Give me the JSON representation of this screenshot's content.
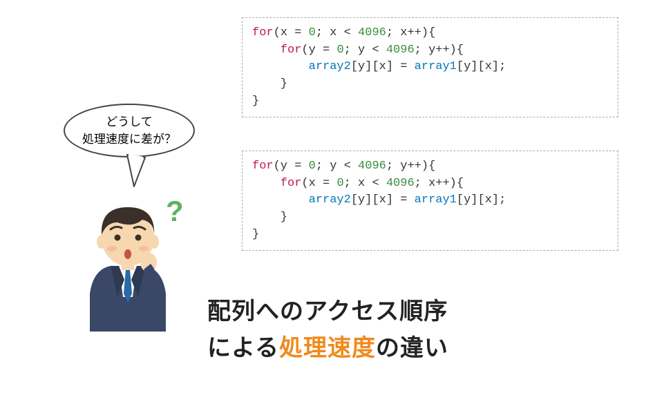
{
  "bubble": {
    "line1": "どうして",
    "line2": "処理速度に差が？"
  },
  "code1": {
    "outer_kw": "for",
    "outer_open": "(x = ",
    "outer_init": "0",
    "outer_cond": "; x < ",
    "outer_limit": "4096",
    "outer_inc": "; x++){",
    "inner_kw": "for",
    "inner_open": "(y = ",
    "inner_init": "0",
    "inner_cond": "; y < ",
    "inner_limit": "4096",
    "inner_inc": "; y++){",
    "arr2": "array2",
    "idx_mid": "[y][x] = ",
    "arr1": "array1",
    "idx_end": "[y][x];",
    "close_inner": "    }",
    "close_outer": "}"
  },
  "code2": {
    "outer_kw": "for",
    "outer_open": "(y = ",
    "outer_init": "0",
    "outer_cond": "; y < ",
    "outer_limit": "4096",
    "outer_inc": "; y++){",
    "inner_kw": "for",
    "inner_open": "(x = ",
    "inner_init": "0",
    "inner_cond": "; x < ",
    "inner_limit": "4096",
    "inner_inc": "; x++){",
    "arr2": "array2",
    "idx_mid": "[y][x] = ",
    "arr1": "array1",
    "idx_end": "[y][x];",
    "close_inner": "    }",
    "close_outer": "}"
  },
  "title": {
    "line1": "配列へのアクセス順序",
    "line2a": "による",
    "line2b": "処理速度",
    "line2c": "の違い"
  },
  "icons": {
    "question_mark": "?"
  }
}
